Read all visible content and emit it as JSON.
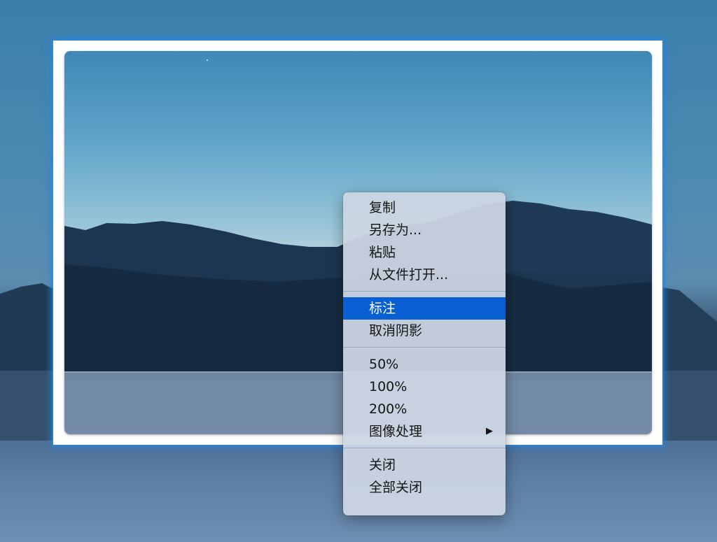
{
  "context_menu": {
    "items": [
      {
        "label": "复制"
      },
      {
        "label": "另存为..."
      },
      {
        "label": "粘贴"
      },
      {
        "label": "从文件打开..."
      },
      {
        "separator": true
      },
      {
        "label": "标注",
        "highlighted": true
      },
      {
        "label": "取消阴影"
      },
      {
        "separator": true
      },
      {
        "label": "50%"
      },
      {
        "label": "100%"
      },
      {
        "label": "200%"
      },
      {
        "label": "图像处理",
        "submenu": true,
        "submenu_icon": "triangle-right-icon"
      },
      {
        "separator": true
      },
      {
        "label": "关闭"
      },
      {
        "label": "全部关闭"
      }
    ]
  },
  "colors": {
    "highlight": "#0a5fd3",
    "frame_glow": "#2882dc"
  }
}
